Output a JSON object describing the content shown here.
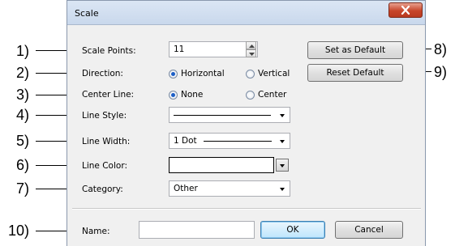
{
  "callouts": [
    "1)",
    "2)",
    "3)",
    "4)",
    "5)",
    "6)",
    "7)",
    "8)",
    "9)",
    "10)"
  ],
  "dialog": {
    "title": "Scale",
    "scale_points": {
      "label": "Scale Points:",
      "value": "11"
    },
    "direction": {
      "label": "Direction:",
      "options": [
        "Horizontal",
        "Vertical"
      ],
      "selected": "Horizontal"
    },
    "center_line": {
      "label": "Center Line:",
      "options": [
        "None",
        "Center"
      ],
      "selected": "None"
    },
    "line_style": {
      "label": "Line Style:",
      "value": ""
    },
    "line_width": {
      "label": "Line Width:",
      "value": "1 Dot"
    },
    "line_color": {
      "label": "Line Color:",
      "value_color": "#ffffff"
    },
    "category": {
      "label": "Category:",
      "value": "Other"
    },
    "name": {
      "label": "Name:",
      "value": ""
    },
    "buttons": {
      "set_default": "Set as Default",
      "reset_default": "Reset Default",
      "ok": "OK",
      "cancel": "Cancel"
    }
  },
  "colors": {
    "accent": "#1b5ec6",
    "close_button": "#c7452a"
  }
}
